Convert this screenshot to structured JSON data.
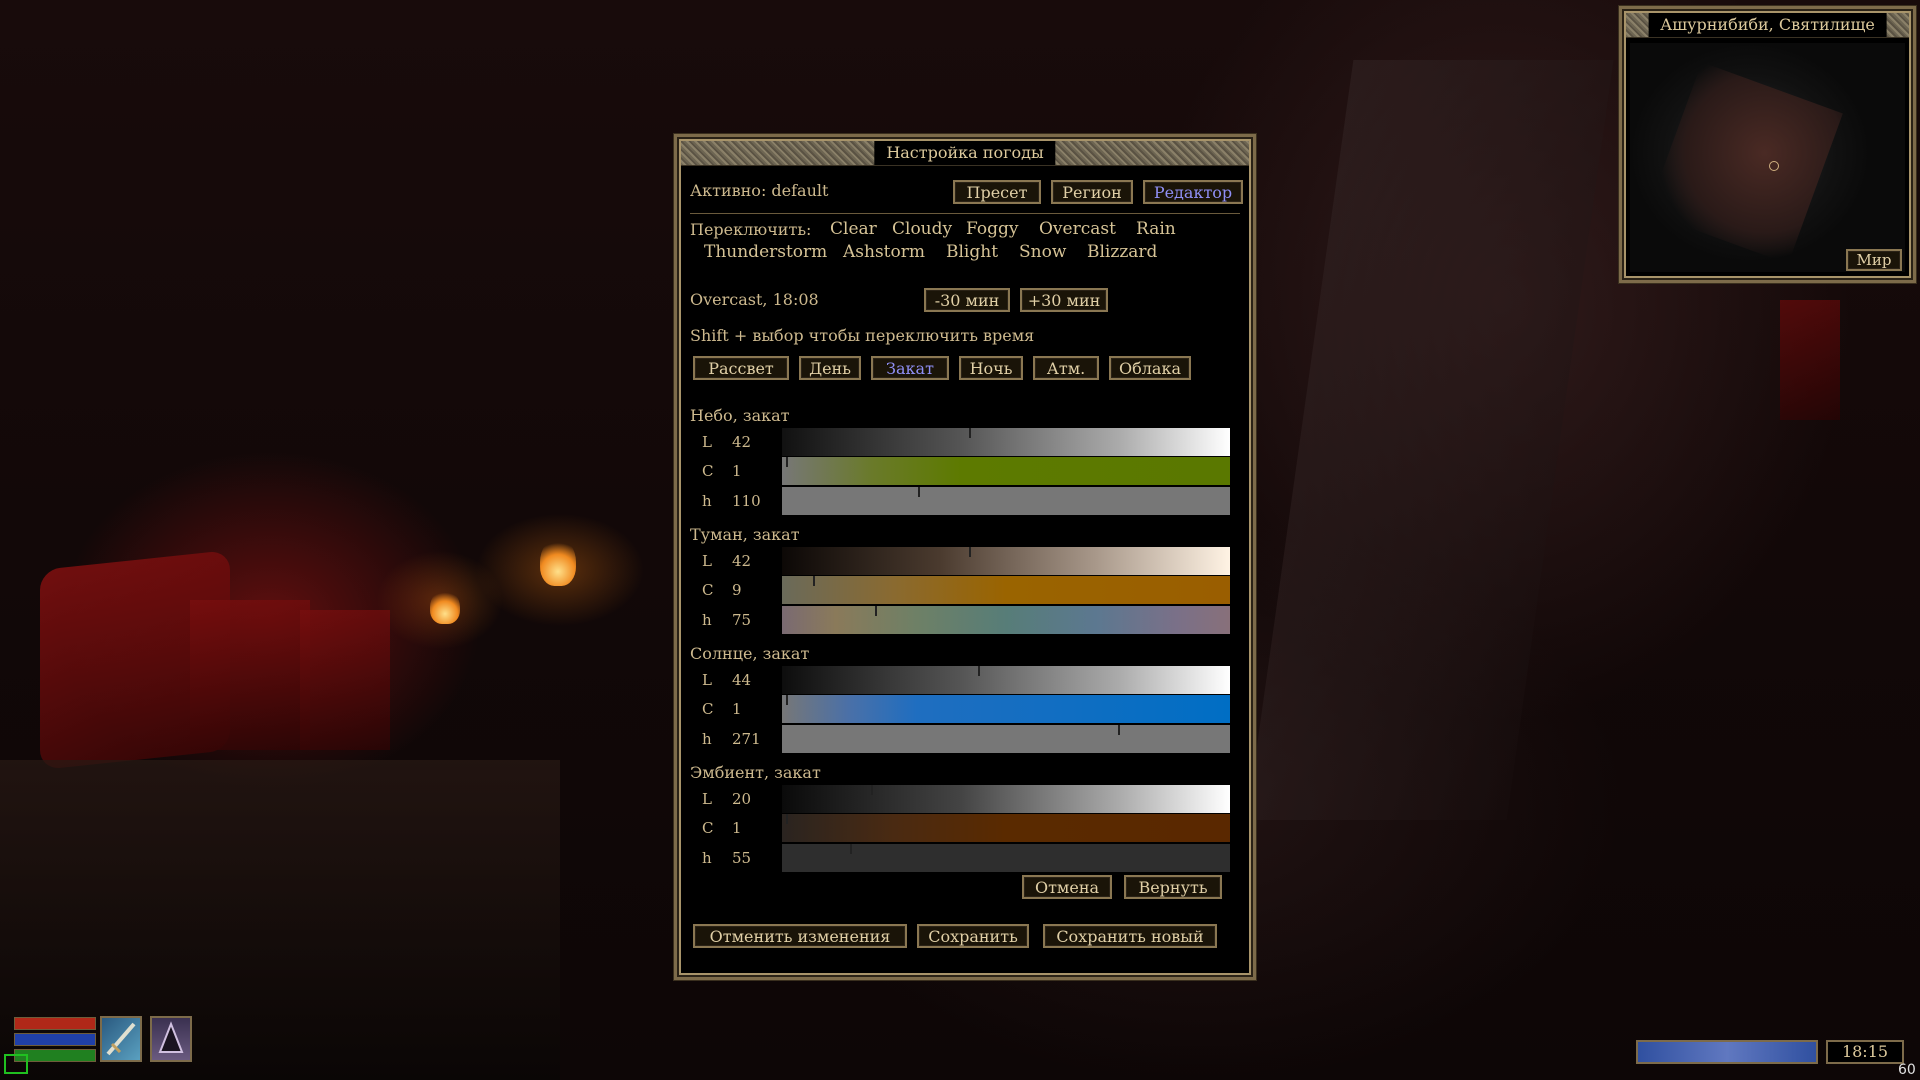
{
  "weather_window": {
    "title": "Настройка погоды",
    "active_label": "Активно: default",
    "mode_tabs": [
      {
        "label": "Пресет",
        "active": false
      },
      {
        "label": "Регион",
        "active": false
      },
      {
        "label": "Редактор",
        "active": true
      }
    ],
    "switch_label": "Переключить:",
    "weathers_row1": [
      "Clear",
      "Cloudy",
      "Foggy",
      "Overcast",
      "Rain"
    ],
    "weathers_row2": [
      "Thunderstorm",
      "Ashstorm",
      "Blight",
      "Snow",
      "Blizzard"
    ],
    "status": "Overcast, 18:08",
    "time_minus": "-30 мин",
    "time_plus": "+30 мин",
    "shift_hint": "Shift + выбор чтобы переключить время",
    "time_tabs": [
      {
        "label": "Рассвет",
        "active": false
      },
      {
        "label": "День",
        "active": false
      },
      {
        "label": "Закат",
        "active": true
      },
      {
        "label": "Ночь",
        "active": false
      },
      {
        "label": "Атм.",
        "active": false
      },
      {
        "label": "Облака",
        "active": false
      }
    ],
    "sections": [
      {
        "title": "Небо, закат",
        "rows": [
          {
            "label": "L",
            "value": "42",
            "gradient": "linear-gradient(90deg,#111 0%,#555 40%,#aaa 75%,#fff 100%)",
            "level": 0.42
          },
          {
            "label": "C",
            "value": "1",
            "gradient": "linear-gradient(90deg,#777 0%,#6a7a2a 20%,#5d7a00 40%,#5a7800 100%)",
            "level": 0.01
          },
          {
            "label": "h",
            "value": "110",
            "gradient": "linear-gradient(90deg,#777 0%,#777 100%)",
            "level": 0.306
          }
        ]
      },
      {
        "title": "Туман, закат",
        "rows": [
          {
            "label": "L",
            "value": "42",
            "gradient": "linear-gradient(90deg,#0c0806 0%,#4a3a2e 35%,#a8988a 70%,#fff3e4 100%)",
            "level": 0.42
          },
          {
            "label": "C",
            "value": "9",
            "gradient": "linear-gradient(90deg,#6a6a5a 0%,#8a6a30 25%,#9a6400 50%,#9a5e00 100%)",
            "level": 0.07
          },
          {
            "label": "h",
            "value": "75",
            "gradient": "linear-gradient(90deg,#7a6a72 0%,#8a7a5a 12%,#6e8066 30%,#577d78 50%,#5c7890 70%,#7a7088 88%,#88707a 100%)",
            "level": 0.208
          }
        ]
      },
      {
        "title": "Солнце, закат",
        "rows": [
          {
            "label": "L",
            "value": "44",
            "gradient": "linear-gradient(90deg,#0d0d0d 0%,#555 40%,#aaa 75%,#fff 100%)",
            "level": 0.44
          },
          {
            "label": "C",
            "value": "1",
            "gradient": "linear-gradient(90deg,#777 0%,#4a70a8 15%,#1f6ec0 30%,#006ec4 100%)",
            "level": 0.01
          },
          {
            "label": "h",
            "value": "271",
            "gradient": "linear-gradient(90deg,#777 0%,#777 100%)",
            "level": 0.753
          }
        ]
      },
      {
        "title": "Эмбиент, закат",
        "rows": [
          {
            "label": "L",
            "value": "20",
            "gradient": "linear-gradient(90deg,#0a0a0a 0%,#444 40%,#aaa 75%,#fff 100%)",
            "level": 0.2
          },
          {
            "label": "C",
            "value": "1",
            "gradient": "linear-gradient(90deg,#2a2420 0%,#4a2a12 25%,#5a2a00 50%,#5a2800 100%)",
            "level": 0.01
          },
          {
            "label": "h",
            "value": "55",
            "gradient": "linear-gradient(90deg,#2e2e2e 0%,#2e2e2e 100%)",
            "level": 0.153
          }
        ]
      }
    ],
    "cancel_label": "Отмена",
    "revert_label": "Вернуть",
    "discard_label": "Отменить изменения",
    "save_label": "Сохранить",
    "save_new_label": "Сохранить новый"
  },
  "minimap": {
    "title": "Ашурнибиби, Святилище",
    "world_button": "Мир"
  },
  "hud": {
    "clock": "18:15",
    "fps": "60",
    "health_color": "#b02818",
    "magicka_color": "#2040a8",
    "fatigue_color": "#208020",
    "weapon_icon": "dagger-icon",
    "spell_icon": "shrine-spell-icon"
  }
}
